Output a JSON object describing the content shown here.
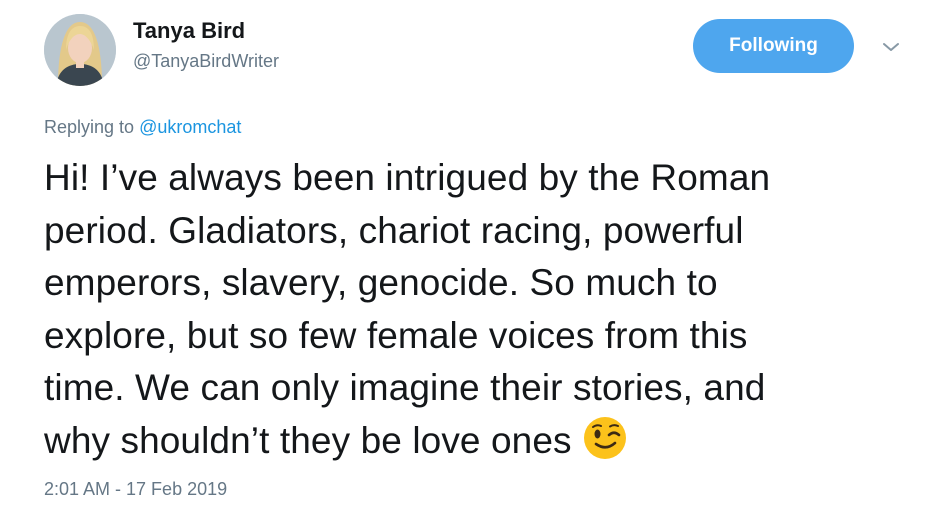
{
  "author": {
    "display_name": "Tanya Bird",
    "handle": "@TanyaBirdWriter",
    "avatar_icon": "profile-photo"
  },
  "actions": {
    "follow_label": "Following",
    "menu_icon": "chevron-down-icon"
  },
  "reply": {
    "prefix": "Replying to ",
    "mention": "@ukromchat"
  },
  "tweet": {
    "lines": [
      "Hi! I’ve always been intrigued by the Roman",
      "period. Gladiators, chariot racing, powerful",
      "emperors, slavery, genocide. So much to",
      "explore, but so few female voices from this",
      "time. We can only imagine their stories, and",
      "why shouldn’t they be love ones"
    ],
    "emoji": "winking-face"
  },
  "timestamp": "2:01 AM - 17 Feb 2019",
  "colors": {
    "accent": "#4ea6ee",
    "link": "#1b95e0",
    "secondary_text": "#657786",
    "primary_text": "#14171a"
  }
}
